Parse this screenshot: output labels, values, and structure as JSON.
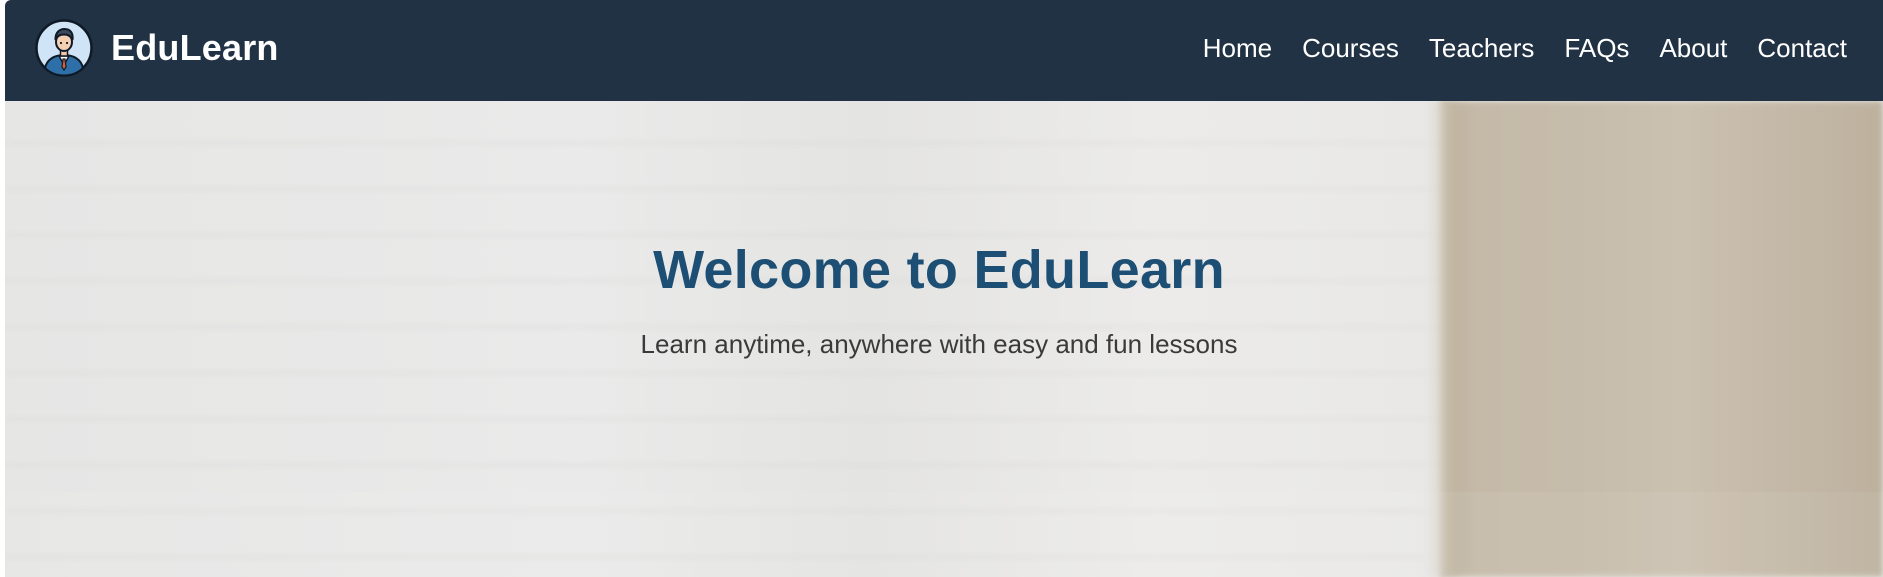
{
  "brand": {
    "name": "EduLearn",
    "logo_icon": "teacher-avatar-icon"
  },
  "nav": {
    "items": [
      {
        "label": "Home"
      },
      {
        "label": "Courses"
      },
      {
        "label": "Teachers"
      },
      {
        "label": "FAQs"
      },
      {
        "label": "About"
      },
      {
        "label": "Contact"
      }
    ]
  },
  "hero": {
    "title": "Welcome to EduLearn",
    "subtitle": "Learn anytime, anywhere with easy and fun lessons"
  },
  "colors": {
    "navbar_bg": "#213245",
    "title": "#1d4e74",
    "nav_text": "#ffffff"
  }
}
